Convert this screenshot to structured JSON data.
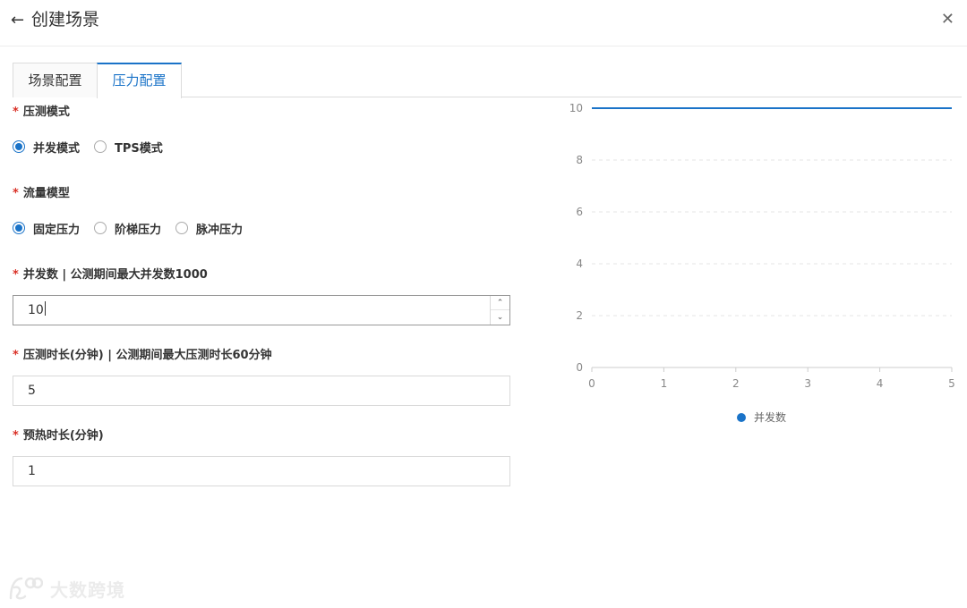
{
  "header": {
    "title": "创建场景"
  },
  "tabs": [
    {
      "label": "场景配置",
      "active": false
    },
    {
      "label": "压力配置",
      "active": true
    }
  ],
  "form": {
    "required_mark": "*",
    "pressure_mode": {
      "label": "压测模式",
      "options": [
        "并发模式",
        "TPS模式"
      ],
      "selected": "并发模式"
    },
    "traffic_model": {
      "label": "流量模型",
      "options": [
        "固定压力",
        "阶梯压力",
        "脉冲压力"
      ],
      "selected": "固定压力"
    },
    "concurrency": {
      "label": "并发数 | 公测期间最大并发数1000",
      "value": "10"
    },
    "duration": {
      "label": "压测时长(分钟) | 公测期间最大压测时长60分钟",
      "value": "5"
    },
    "warmup": {
      "label": "预热时长(分钟)",
      "value": "1"
    }
  },
  "chart_data": {
    "type": "line",
    "x": [
      0,
      5
    ],
    "series": [
      {
        "name": "并发数",
        "values": [
          10,
          10
        ]
      }
    ],
    "xticks": [
      "0",
      "1",
      "2",
      "3",
      "4",
      "5"
    ],
    "yticks": [
      "0",
      "2",
      "4",
      "6",
      "8",
      "10"
    ],
    "xlim": [
      0,
      5
    ],
    "ylim": [
      0,
      10
    ],
    "grid": true,
    "legend_position": "bottom-center",
    "colors": {
      "line": "#1a73c8",
      "grid": "#e6e6e6",
      "axis": "#cccccc",
      "tick_text": "#888888"
    }
  },
  "watermark": {
    "text": "大数跨境"
  }
}
